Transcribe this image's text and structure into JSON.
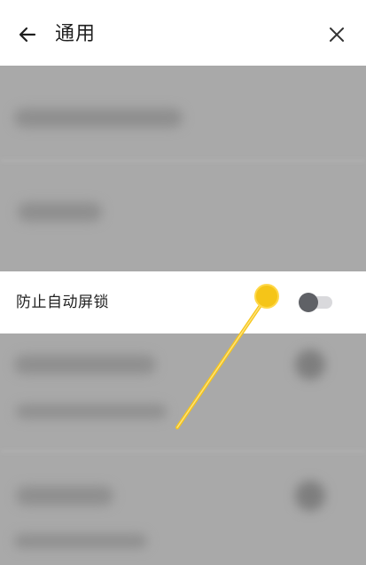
{
  "header": {
    "title": "通用",
    "back_icon": "arrow-left-icon",
    "close_icon": "close-icon"
  },
  "highlight_row": {
    "label": "防止自动屏锁",
    "toggle_state": "off"
  },
  "colors": {
    "overlay": "#a9a9a9",
    "toggle_knob": "#5f6166",
    "toggle_track": "#d9d9dc",
    "pointer": "#f5c518"
  }
}
